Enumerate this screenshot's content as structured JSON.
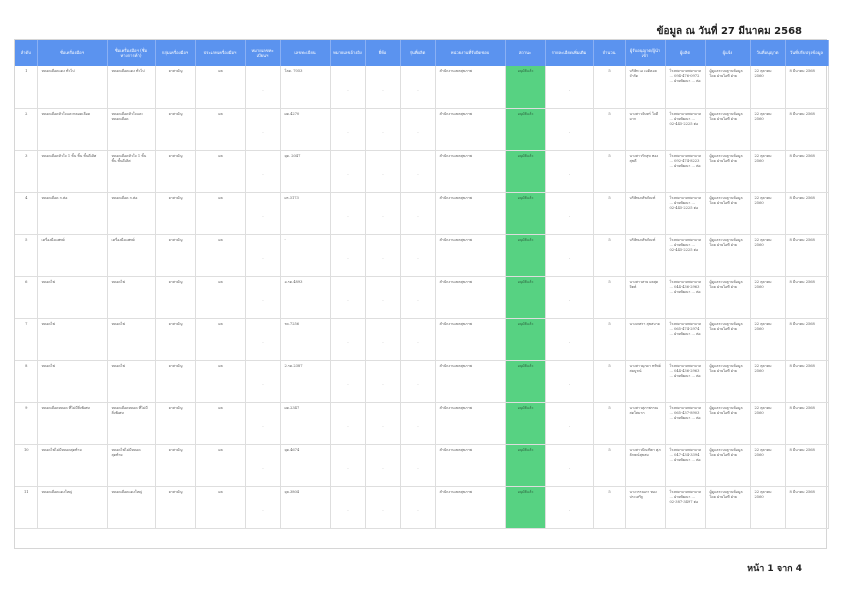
{
  "header": {
    "date_line": "ข้อมูล ณ วันที่ 27 มีนาคม 2568"
  },
  "footer": {
    "page_label": "หน้า 1 จาก 4"
  },
  "columns": [
    "ลำดับ",
    "ชื่อเครื่องมือฯ",
    "ชื่อเครื่องมือฯ (ชื่อทางการค้า)",
    "กลุ่มเครื่องมือฯ",
    "ประเภทเครื่องมือฯ",
    "หมายเลขทะเบียนฯ",
    "เลขทะเบียน",
    "หมายเลขอ้างอิง",
    "ยี่ห้อ",
    "รุ่นที่ผลิต",
    "หน่วยงานที่รับผิดชอบ",
    "สถานะ",
    "รายละเอียดเพิ่มเติม",
    "จำนวน",
    "ผู้รับอนุญาต/ผู้นำเข้า",
    "ผู้ผลิต",
    "ผู้แจ้ง",
    "วันที่อนุญาต",
    "วันที่ปรับปรุงข้อมูล"
  ],
  "common": {
    "group": "ยาสามัญ",
    "type": "ผล",
    "agency": "สำนักงานเขตสุขภาพ",
    "status": "อนุมัติแล้ว",
    "qty": "5",
    "notifier": "ผู้ดูแลระบบฐานข้อมูล โดย ฝ่ายไอที ฝ่าย",
    "approved": "22 ตุลาคม 2560",
    "updated": "8 มีนาคม 2568",
    "dash": "-"
  },
  "rows": [
    {
      "no": "1",
      "name": "หลอดเลือดแดง ทั่วไป",
      "trade": "หลอดเลือดแดง ทั่วไป",
      "type": "ผล",
      "reg": "โลด. 7053",
      "importer": "บริษัท เอ เมดิคอล จำกัด",
      "maker": "โรงพยาบาลพยาบาล ... 094-476-0972 ... ฝ่ายพัฒนา ... ต่อ"
    },
    {
      "no": "2",
      "name": "หลอดเลือดหัวใจและหลอดเลือด",
      "trade": "หลอดเลือดหัวใจและหลอดเลือด",
      "type": "ผล",
      "reg": "ผด.4270",
      "importer": "นางสาวจันทร์ ใจดีมาก",
      "maker": "โรงพยาบาลพยาบาล ... ฝ่ายพัฒนา ... 02-445-2225 ต่อ"
    },
    {
      "no": "3",
      "name": "หลอดเลือดหัวใจ 1 ชั้น ชิ้น ชั้นดีเลิศ",
      "trade": "หลอดเลือดหัวใจ 1 ชั้น ชิ้น ชั้นดีเลิศ",
      "type": "ผล",
      "reg": "ยุด. 2047",
      "importer": "นางสาวรักสุข ทองสุขดี",
      "maker": "โรงพยาบาลพยาบาล ... 092-474-8223 ... ฝ่ายพัฒนา ... ต่อ"
    },
    {
      "no": "4",
      "name": "หลอดเลือด ก.ต่อ",
      "trade": "หลอดเลือด ก.ต่อ",
      "type": "ผล",
      "reg": "ผร.3173",
      "importer": "บริษัทเภสัชภัณฑ์",
      "maker": "โรงพยาบาลพยาบาล ... ฝ่ายพัฒนา ... 02-445-2225 ต่อ"
    },
    {
      "no": "5",
      "name": "เครื่องมือแพทย์",
      "trade": "เครื่องมือแพทย์",
      "type": "ผล",
      "reg": "-",
      "importer": "บริษัทเภสัชภัณฑ์",
      "maker": "โรงพยาบาลพยาบาล ... ฝ่ายพัฒนา ... 02-445-2225 ต่อ"
    },
    {
      "no": "6",
      "name": "หลอดไฟ",
      "trade": "หลอดไฟ",
      "type": "ผล",
      "reg": "อ.รด.4893",
      "importer": "นางสาวสาย ผลสุดจิตต์",
      "maker": "โรงพยาบาลพยาบาล ... 044-436-2963 ... ฝ่ายพัฒนา ... ต่อ"
    },
    {
      "no": "7",
      "name": "หลอดไฟ",
      "trade": "หลอดไฟ",
      "type": "ผล",
      "reg": "รด.7256",
      "importer": "นางเกศรา สุขสบาย",
      "maker": "โรงพยาบาลพยาบาล ... 065-474-2974 ... ฝ่ายพัฒนา ... ต่อ"
    },
    {
      "no": "8",
      "name": "หลอดไฟ",
      "trade": "หลอดไฟ",
      "type": "ผล",
      "reg": "2.รด.2387",
      "importer": "นางสาวมุกดา ทรัพย์สมบูรณ์",
      "maker": "โรงพยาบาลพยาบาล ... 044-436-2963 ... ฝ่ายพัฒนา ... ต่อ"
    },
    {
      "no": "9",
      "name": "หลอดเลือดหลอด ที่ไม่มีสิ่งพิเศษ",
      "trade": "หลอดเลือดหลอด ที่ไม่มีสิ่งพิเศษ",
      "type": "ผล",
      "reg": "ผด.2347",
      "importer": "นางสาวสุภาพรรณ สดใสมาก",
      "maker": "โรงพยาบาลพยาบาล ... 065-437-8903 ... ฝ่ายพัฒนา ... ต่อ"
    },
    {
      "no": "10",
      "name": "หลอดไฟไม่มีหลอดสุดท้าย",
      "trade": "หลอดไฟไม่มีหลอดสุดท้าย",
      "type": "ผล",
      "reg": "ยุด.4674",
      "importer": "นางสาวปัณฑิตา ศุภลักษณ์สุขสม",
      "maker": "โรงพยาบาลพยาบาล ... 047-434-3394 ... ฝ่ายพัฒนา ... ต่อ"
    },
    {
      "no": "11",
      "name": "หลอดเลือดแดงใหญ่",
      "trade": "หลอดเลือดแดงใหญ่",
      "type": "ผล",
      "reg": "ยุล.3804",
      "importer": "นางวรรณภา ทองประเสริฐ",
      "maker": "โรงพยาบาลพยาบาล ... ฝ่ายพัฒนา ... 02-387-3497 ต่อ"
    }
  ]
}
